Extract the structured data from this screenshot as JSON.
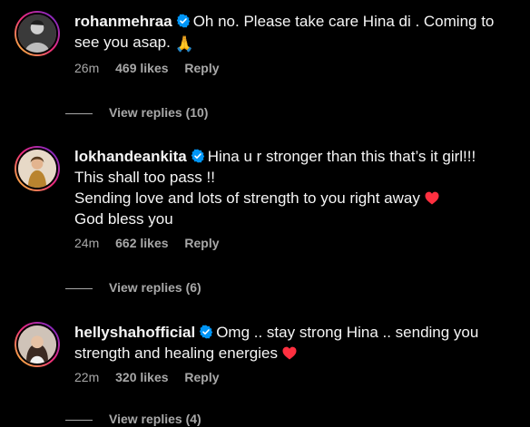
{
  "comments": [
    {
      "username": "rohanmehraa",
      "lines": [
        "Oh no. Please take care Hina di . Coming to",
        "see you asap."
      ],
      "emoji": "🙏",
      "time": "26m",
      "likes": "469 likes",
      "reply": "Reply",
      "view_replies": "View replies (10)"
    },
    {
      "username": "lokhandeankita",
      "lines": [
        "Hina u r stronger than this that’s it girl!!!",
        "This shall too pass !!",
        "Sending love and lots of strength to you right away",
        "God bless you"
      ],
      "time": "24m",
      "likes": "662 likes",
      "reply": "Reply",
      "view_replies": "View replies (6)"
    },
    {
      "username": "hellyshahofficial",
      "lines": [
        "Omg .. stay strong Hina .. sending you",
        "strength and healing energies"
      ],
      "time": "22m",
      "likes": "320 likes",
      "reply": "Reply",
      "view_replies": "View replies (4)"
    }
  ],
  "colors": {
    "background": "#000000",
    "text": "#f5f5f5",
    "secondary": "#a8a8a8",
    "verified": "#0095f6",
    "heart": "#ff3040"
  },
  "icons": [
    "verified-badge-icon",
    "folded-hands-emoji",
    "red-heart-emoji"
  ]
}
